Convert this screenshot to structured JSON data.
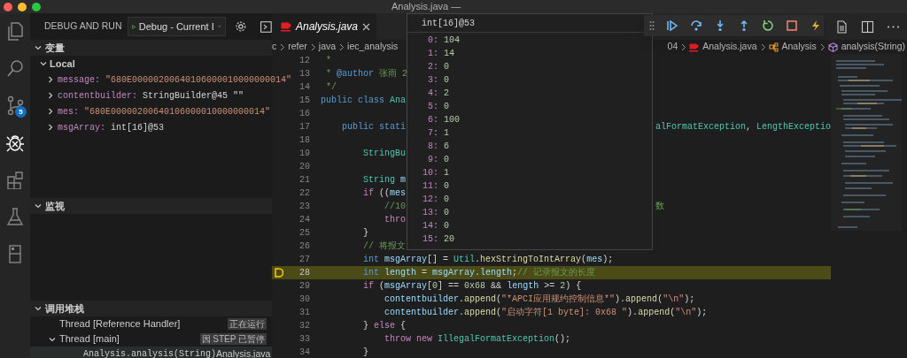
{
  "window": {
    "title": "Analysis.java —"
  },
  "activity_bar": [
    {
      "kind": "explorer",
      "selected": false
    },
    {
      "kind": "search",
      "selected": false
    },
    {
      "kind": "source-control",
      "selected": false,
      "badge": "5"
    },
    {
      "kind": "debug",
      "selected": true
    },
    {
      "kind": "extensions",
      "selected": false
    },
    {
      "kind": "testing",
      "selected": false
    },
    {
      "kind": "panel",
      "selected": false
    }
  ],
  "sidebar": {
    "title": "DEBUG AND RUN",
    "config": "Debug - Current I",
    "variables": {
      "title": "变量",
      "expanded": true,
      "scope": {
        "label": "Local",
        "expanded": true
      },
      "items": [
        {
          "name": "message:",
          "value": "\"680E00000200640106000010000000014\"",
          "kind": "string"
        },
        {
          "name": "contentbuilder:",
          "value": "StringBuilder@45 \"\"",
          "kind": "object"
        },
        {
          "name": "mes:",
          "value": "\"680E00000200640106000010000000014\"",
          "kind": "string"
        },
        {
          "name": "msgArray:",
          "value": "int[16]@53",
          "kind": "object"
        }
      ]
    },
    "watch": {
      "title": "监视",
      "expanded": true
    },
    "call_stack": {
      "title": "调用堆栈",
      "expanded": true,
      "threads": [
        {
          "name": "Thread [Reference Handler]",
          "status": "正在运行"
        },
        {
          "name": "Thread [main]",
          "status": "因 STEP 已暂停",
          "expanded": true,
          "children": [
            {
              "name": "Analysis.analysis(String)",
              "file": "Analysis.java",
              "selected": true
            }
          ]
        }
      ]
    }
  },
  "editor": {
    "tab": {
      "label": "Analysis.java"
    },
    "breadcrumb_left": [
      "c",
      "refer",
      "java",
      "iec_analysis"
    ],
    "breadcrumb_right": [
      {
        "kind": "folder",
        "text": "04"
      },
      {
        "kind": "file",
        "text": "Analysis.java"
      },
      {
        "kind": "class",
        "text": "Analysis"
      },
      {
        "kind": "method",
        "text": "analysis(String)"
      }
    ],
    "lines": [
      {
        "number": "12",
        "current": false,
        "tokens": [
          {
            "kind": "comment",
            "text": " *"
          }
        ]
      },
      {
        "number": "13",
        "current": false,
        "tokens": [
          {
            "kind": "comment",
            "text": " * "
          },
          {
            "kind": "doc",
            "text": "@author"
          },
          {
            "kind": "comment",
            "text": " 张雨 2"
          }
        ]
      },
      {
        "number": "14",
        "current": false,
        "tokens": [
          {
            "kind": "comment",
            "text": " */"
          }
        ]
      },
      {
        "number": "15",
        "current": false,
        "tokens": [
          {
            "kind": "keyword",
            "text": "public class "
          },
          {
            "kind": "type",
            "text": "Ana"
          }
        ]
      },
      {
        "number": "16",
        "current": false
      },
      {
        "number": "17",
        "current": false,
        "tokens": [
          {
            "kind": "keyword",
            "text": "    public stati"
          }
        ],
        "tokens_right": [
          {
            "kind": "type",
            "text": "alFormatException"
          },
          {
            "kind": "plain",
            "text": ", "
          },
          {
            "kind": "type",
            "text": "LengthExceptio"
          }
        ]
      },
      {
        "number": "18",
        "current": false
      },
      {
        "number": "19",
        "current": false,
        "tokens": [
          {
            "kind": "type",
            "text": "        StringBu"
          }
        ]
      },
      {
        "number": "20",
        "current": false
      },
      {
        "number": "21",
        "current": false,
        "tokens": [
          {
            "kind": "type",
            "text": "        String "
          },
          {
            "kind": "variable",
            "text": "m"
          }
        ]
      },
      {
        "number": "22",
        "current": false,
        "tokens": [
          {
            "kind": "control",
            "text": "        if"
          },
          {
            "kind": "plain",
            "text": " (("
          },
          {
            "kind": "variable",
            "text": "mes"
          }
        ]
      },
      {
        "number": "23",
        "current": false,
        "tokens": [
          {
            "kind": "comment",
            "text": "            //10"
          }
        ],
        "tokens_right": [
          {
            "kind": "comment",
            "text": "数"
          }
        ]
      },
      {
        "number": "24",
        "current": false,
        "tokens": [
          {
            "kind": "control",
            "text": "            thro"
          }
        ]
      },
      {
        "number": "25",
        "current": false,
        "tokens": [
          {
            "kind": "plain",
            "text": "        }"
          }
        ]
      },
      {
        "number": "26",
        "current": false,
        "tokens": [
          {
            "kind": "comment",
            "text": "        // 将报文"
          }
        ]
      },
      {
        "number": "27",
        "current": false,
        "tokens": [
          {
            "kind": "keyword",
            "text": "        int "
          },
          {
            "kind": "variable",
            "text": "msgArray"
          },
          {
            "kind": "plain",
            "text": "[] = "
          },
          {
            "kind": "type",
            "text": "Util"
          },
          {
            "kind": "plain",
            "text": "."
          },
          {
            "kind": "function",
            "text": "hexStringToIntArray"
          },
          {
            "kind": "plain",
            "text": "("
          },
          {
            "kind": "variable",
            "text": "mes"
          },
          {
            "kind": "plain",
            "text": ");"
          }
        ]
      },
      {
        "number": "28",
        "current": true,
        "tokens": [
          {
            "kind": "keyword",
            "text": "        int "
          },
          {
            "kind": "variable",
            "text": "length"
          },
          {
            "kind": "plain",
            "text": " = "
          },
          {
            "kind": "variable",
            "text": "msgArray"
          },
          {
            "kind": "plain",
            "text": "."
          },
          {
            "kind": "variable",
            "text": "length"
          },
          {
            "kind": "plain",
            "text": ";"
          },
          {
            "kind": "comment",
            "text": "// 记录报文的长度"
          }
        ]
      },
      {
        "number": "29",
        "current": false,
        "tokens": [
          {
            "kind": "control",
            "text": "        if"
          },
          {
            "kind": "plain",
            "text": " ("
          },
          {
            "kind": "variable",
            "text": "msgArray"
          },
          {
            "kind": "plain",
            "text": "["
          },
          {
            "kind": "number",
            "text": "0"
          },
          {
            "kind": "plain",
            "text": "] == "
          },
          {
            "kind": "number",
            "text": "0x68"
          },
          {
            "kind": "plain",
            "text": " && "
          },
          {
            "kind": "variable",
            "text": "length"
          },
          {
            "kind": "plain",
            "text": " >= "
          },
          {
            "kind": "number",
            "text": "2"
          },
          {
            "kind": "plain",
            "text": ") {"
          }
        ]
      },
      {
        "number": "30",
        "current": false,
        "tokens": [
          {
            "kind": "variable",
            "text": "            contentbuilder"
          },
          {
            "kind": "plain",
            "text": "."
          },
          {
            "kind": "function",
            "text": "append"
          },
          {
            "kind": "plain",
            "text": "("
          },
          {
            "kind": "string",
            "text": "\"*APCI应用规约控制信息*\""
          },
          {
            "kind": "plain",
            "text": ")."
          },
          {
            "kind": "function",
            "text": "append"
          },
          {
            "kind": "plain",
            "text": "("
          },
          {
            "kind": "string",
            "text": "\"\\n\""
          },
          {
            "kind": "plain",
            "text": ");"
          }
        ]
      },
      {
        "number": "31",
        "current": false,
        "tokens": [
          {
            "kind": "variable",
            "text": "            contentbuilder"
          },
          {
            "kind": "plain",
            "text": "."
          },
          {
            "kind": "function",
            "text": "append"
          },
          {
            "kind": "plain",
            "text": "("
          },
          {
            "kind": "string",
            "text": "\"启动字符[1 byte]: 0x68 \""
          },
          {
            "kind": "plain",
            "text": ")."
          },
          {
            "kind": "function",
            "text": "append"
          },
          {
            "kind": "plain",
            "text": "("
          },
          {
            "kind": "string",
            "text": "\"\\n\""
          },
          {
            "kind": "plain",
            "text": ");"
          }
        ]
      },
      {
        "number": "32",
        "current": false,
        "tokens": [
          {
            "kind": "plain",
            "text": "        } "
          },
          {
            "kind": "control",
            "text": "else"
          },
          {
            "kind": "plain",
            "text": " {"
          }
        ]
      },
      {
        "number": "33",
        "current": false,
        "tokens": [
          {
            "kind": "control",
            "text": "            throw new "
          },
          {
            "kind": "type",
            "text": "IllegalFormatException"
          },
          {
            "kind": "plain",
            "text": "();"
          }
        ]
      },
      {
        "number": "34",
        "current": false,
        "tokens": [
          {
            "kind": "plain",
            "text": "        }"
          }
        ]
      }
    ]
  },
  "hover": {
    "title": "int[16]@53",
    "entries": [
      {
        "index": "0:",
        "value": "104"
      },
      {
        "index": "1:",
        "value": "14"
      },
      {
        "index": "2:",
        "value": "0"
      },
      {
        "index": "3:",
        "value": "0"
      },
      {
        "index": "4:",
        "value": "2"
      },
      {
        "index": "5:",
        "value": "0"
      },
      {
        "index": "6:",
        "value": "100"
      },
      {
        "index": "7:",
        "value": "1"
      },
      {
        "index": "8:",
        "value": "6"
      },
      {
        "index": "9:",
        "value": "0"
      },
      {
        "index": "10:",
        "value": "1"
      },
      {
        "index": "11:",
        "value": "0"
      },
      {
        "index": "12:",
        "value": "0"
      },
      {
        "index": "13:",
        "value": "0"
      },
      {
        "index": "14:",
        "value": "0"
      },
      {
        "index": "15:",
        "value": "20"
      }
    ]
  },
  "debug_toolbar": [
    {
      "kind": "continue"
    },
    {
      "kind": "step-over"
    },
    {
      "kind": "step-into"
    },
    {
      "kind": "step-out"
    },
    {
      "kind": "restart"
    },
    {
      "kind": "stop"
    },
    {
      "kind": "hot-replace"
    }
  ],
  "editor_actions": [
    {
      "kind": "preview"
    },
    {
      "kind": "split"
    },
    {
      "kind": "more"
    }
  ]
}
